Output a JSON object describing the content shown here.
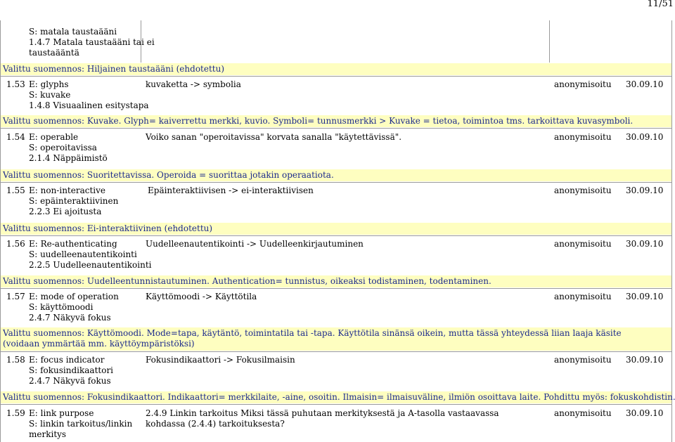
{
  "page_number": "11/51",
  "top_block": {
    "lines": [
      "S: matala taustaääni",
      "1.4.7 Matala taustaääni tai ei",
      "taustaääntä"
    ],
    "note": "Valittu suomennos: Hiljainen taustaääni (ehdotettu)"
  },
  "entries": [
    {
      "num": "1.53",
      "en": "E: glyphs",
      "fi": "S: kuvake",
      "ref": "1.4.8 Visuaalinen esitystapa",
      "proposal": "kuvaketta -> symbolia",
      "author": "anonymisoitu",
      "date": "30.09.10",
      "note": "Valittu suomennos: Kuvake. Glyph= kaiverrettu merkki, kuvio. Symboli= tunnusmerkki > Kuvake = tietoa, toimintoa tms. tarkoittava kuvasymboli."
    },
    {
      "num": "1.54",
      "en": "E: operable",
      "fi": "S: operoitavissa",
      "ref": "2.1.4 Näppäimistö",
      "proposal": "Voiko sanan \"operoitavissa\" korvata sanalla \"käytettävissä\".",
      "author": "anonymisoitu",
      "date": "30.09.10",
      "note": "Valittu suomennos: Suoritettavissa. Operoida = suorittaa jotakin operaatiota."
    },
    {
      "num": "1.55",
      "en": "E: non-interactive",
      "fi": "S: epäinteraktiivinen",
      "ref": "2.2.3 Ei ajoitusta",
      "proposal": "Epäinteraktiivisen -> ei-interaktiivisen",
      "author": "anonymisoitu",
      "date": "30.09.10",
      "note": "Valittu suomennos: Ei-interaktiivinen (ehdotettu)"
    },
    {
      "num": "1.56",
      "en": "E: Re-authenticating",
      "fi": "S: uudelleenautentikointi",
      "ref": "2.2.5 Uudelleenautentikointi",
      "proposal": "Uudelleenautentikointi -> Uudelleenkirjautuminen",
      "author": "anonymisoitu",
      "date": "30.09.10",
      "note": "Valittu suomennos: Uudelleentunnistautuminen. Authentication= tunnistus, oikeaksi todistaminen, todentaminen."
    },
    {
      "num": "1.57",
      "en": "E: mode of operation",
      "fi": "S: käyttömoodi",
      "ref": "2.4.7 Näkyvä fokus",
      "proposal": "Käyttömoodi -> Käyttötila",
      "author": "anonymisoitu",
      "date": "30.09.10",
      "note": "Valittu suomennos: Käyttömoodi. Mode=tapa, käytäntö, toimintatila tai -tapa. Käyttötila sinänsä oikein, mutta tässä yhteydessä liian laaja käsite (voidaan ymmärtää mm. käyttöympäristöksi)"
    },
    {
      "num": "1.58",
      "en": "E: focus indicator",
      "fi": "S: fokusindikaattori",
      "ref": "2.4.7 Näkyvä fokus",
      "proposal": "Fokusindikaattori -> Fokusilmaisin",
      "author": "anonymisoitu",
      "date": "30.09.10",
      "note": "Valittu suomennos: Fokusindikaattori. Indikaattori= merkkilaite, -aine, osoitin. Ilmaisin= ilmaisuväline, ilmiön osoittava laite. Pohdittu myös: fokuskohdistin."
    },
    {
      "num": "1.59",
      "en": "E: link purpose",
      "fi": "S: linkin tarkoitus/linkin",
      "ref": "merkitys",
      "proposal": "2.4.9 Linkin tarkoitus Miksi tässä puhutaan merkityksestä ja A-tasolla vastaavassa kohdassa (2.4.4) tarkoituksesta?",
      "author": "anonymisoitu",
      "date": "30.09.10",
      "note": ""
    }
  ]
}
